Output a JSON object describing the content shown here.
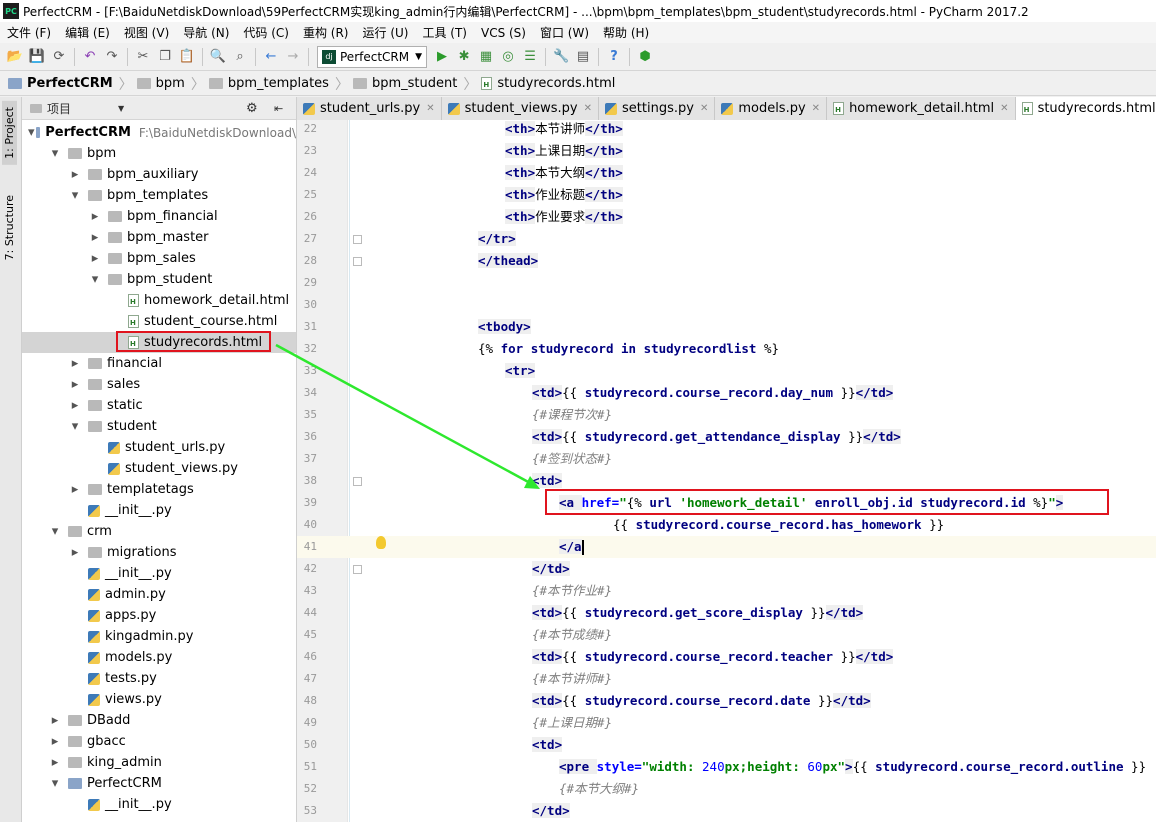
{
  "window": {
    "title": "PerfectCRM - [F:\\BaiduNetdiskDownload\\59PerfectCRM实现king_admin行内编辑\\PerfectCRM] - ...\\bpm\\bpm_templates\\bpm_student\\studyrecords.html - PyCharm 2017.2",
    "logo": "PC"
  },
  "menu": [
    "文件 (F)",
    "编辑 (E)",
    "视图 (V)",
    "导航 (N)",
    "代码 (C)",
    "重构 (R)",
    "运行 (U)",
    "工具 (T)",
    "VCS (S)",
    "窗口 (W)",
    "帮助 (H)"
  ],
  "toolbar": {
    "run_config": "PerfectCRM",
    "run_config_icon": "dj"
  },
  "breadcrumb": [
    "PerfectCRM",
    "bpm",
    "bpm_templates",
    "bpm_student",
    "studyrecords.html"
  ],
  "side_tabs": {
    "project": "1: Project",
    "structure": "7: Structure"
  },
  "project_panel": {
    "header": "项目",
    "root_path": "F:\\BaiduNetdiskDownload\\",
    "tree": [
      {
        "label": "PerfectCRM",
        "depth": 0,
        "kind": "folder",
        "open": true,
        "bold": true
      },
      {
        "label": "bpm",
        "depth": 1,
        "kind": "folder",
        "open": true
      },
      {
        "label": "bpm_auxiliary",
        "depth": 2,
        "kind": "folder",
        "open": false
      },
      {
        "label": "bpm_templates",
        "depth": 2,
        "kind": "folder",
        "open": true
      },
      {
        "label": "bpm_financial",
        "depth": 3,
        "kind": "folder",
        "open": false
      },
      {
        "label": "bpm_master",
        "depth": 3,
        "kind": "folder",
        "open": false
      },
      {
        "label": "bpm_sales",
        "depth": 3,
        "kind": "folder",
        "open": false
      },
      {
        "label": "bpm_student",
        "depth": 3,
        "kind": "folder",
        "open": true
      },
      {
        "label": "homework_detail.html",
        "depth": 4,
        "kind": "html"
      },
      {
        "label": "student_course.html",
        "depth": 4,
        "kind": "html"
      },
      {
        "label": "studyrecords.html",
        "depth": 4,
        "kind": "html",
        "selected": true
      },
      {
        "label": "financial",
        "depth": 2,
        "kind": "folder",
        "open": false
      },
      {
        "label": "sales",
        "depth": 2,
        "kind": "folder",
        "open": false
      },
      {
        "label": "static",
        "depth": 2,
        "kind": "folder",
        "open": false
      },
      {
        "label": "student",
        "depth": 2,
        "kind": "folder",
        "open": true
      },
      {
        "label": "student_urls.py",
        "depth": 3,
        "kind": "py"
      },
      {
        "label": "student_views.py",
        "depth": 3,
        "kind": "py"
      },
      {
        "label": "templatetags",
        "depth": 2,
        "kind": "folder",
        "open": false
      },
      {
        "label": "__init__.py",
        "depth": 2,
        "kind": "py"
      },
      {
        "label": "crm",
        "depth": 1,
        "kind": "folder",
        "open": true
      },
      {
        "label": "migrations",
        "depth": 2,
        "kind": "folder",
        "open": false
      },
      {
        "label": "__init__.py",
        "depth": 2,
        "kind": "py"
      },
      {
        "label": "admin.py",
        "depth": 2,
        "kind": "py"
      },
      {
        "label": "apps.py",
        "depth": 2,
        "kind": "py"
      },
      {
        "label": "kingadmin.py",
        "depth": 2,
        "kind": "py"
      },
      {
        "label": "models.py",
        "depth": 2,
        "kind": "py"
      },
      {
        "label": "tests.py",
        "depth": 2,
        "kind": "py"
      },
      {
        "label": "views.py",
        "depth": 2,
        "kind": "py"
      },
      {
        "label": "DBadd",
        "depth": 1,
        "kind": "folder",
        "open": false
      },
      {
        "label": "gbacc",
        "depth": 1,
        "kind": "folder",
        "open": false
      },
      {
        "label": "king_admin",
        "depth": 1,
        "kind": "folder",
        "open": false
      },
      {
        "label": "PerfectCRM",
        "depth": 1,
        "kind": "folder",
        "open": true
      },
      {
        "label": "__init__.py",
        "depth": 2,
        "kind": "py"
      }
    ]
  },
  "editor_tabs": [
    {
      "label": "student_urls.py",
      "kind": "py"
    },
    {
      "label": "student_views.py",
      "kind": "py"
    },
    {
      "label": "settings.py",
      "kind": "py"
    },
    {
      "label": "models.py",
      "kind": "py"
    },
    {
      "label": "homework_detail.html",
      "kind": "html"
    },
    {
      "label": "studyrecords.html",
      "kind": "html",
      "active": true
    }
  ],
  "code_lines": [
    {
      "n": 22,
      "i": 4,
      "segs": [
        [
          "<",
          "tg"
        ],
        [
          "th",
          "tg"
        ],
        [
          ">",
          "tg"
        ],
        [
          "本节讲师",
          ""
        ],
        [
          "</",
          "tg"
        ],
        [
          "th",
          "tg"
        ],
        [
          ">",
          "tg"
        ]
      ]
    },
    {
      "n": 23,
      "i": 4,
      "segs": [
        [
          "<th>",
          "tg"
        ],
        [
          "上课日期",
          ""
        ],
        [
          "</th>",
          "tg"
        ]
      ]
    },
    {
      "n": 24,
      "i": 4,
      "segs": [
        [
          "<th>",
          "tg"
        ],
        [
          "本节大纲",
          ""
        ],
        [
          "</th>",
          "tg"
        ]
      ]
    },
    {
      "n": 25,
      "i": 4,
      "segs": [
        [
          "<th>",
          "tg"
        ],
        [
          "作业标题",
          ""
        ],
        [
          "</th>",
          "tg"
        ]
      ]
    },
    {
      "n": 26,
      "i": 4,
      "segs": [
        [
          "<th>",
          "tg"
        ],
        [
          "作业要求",
          ""
        ],
        [
          "</th>",
          "tg"
        ]
      ]
    },
    {
      "n": 27,
      "i": 3,
      "segs": [
        [
          "</tr>",
          "tg"
        ]
      ]
    },
    {
      "n": 28,
      "i": 3,
      "segs": [
        [
          "</thead>",
          "tg"
        ]
      ]
    },
    {
      "n": 29,
      "i": 0,
      "segs": []
    },
    {
      "n": 30,
      "i": 0,
      "segs": []
    },
    {
      "n": 31,
      "i": 3,
      "segs": [
        [
          "<tbody>",
          "tg"
        ]
      ]
    },
    {
      "n": 32,
      "i": 3,
      "segs": [
        [
          "{% ",
          ""
        ],
        [
          "for ",
          "kw"
        ],
        [
          "studyrecord ",
          "var"
        ],
        [
          "in ",
          "kw"
        ],
        [
          "studyrecordlist",
          "var"
        ],
        [
          " %}",
          ""
        ]
      ]
    },
    {
      "n": 33,
      "i": 4,
      "segs": [
        [
          "<tr>",
          "tg"
        ]
      ]
    },
    {
      "n": 34,
      "i": 5,
      "segs": [
        [
          "<td>",
          "tg"
        ],
        [
          "{{ ",
          ""
        ],
        [
          "studyrecord.course_record.day_num",
          "var"
        ],
        [
          " }}",
          ""
        ],
        [
          "</td>",
          "tg"
        ]
      ]
    },
    {
      "n": 35,
      "i": 5,
      "segs": [
        [
          "{#课程节次#}",
          "cmt"
        ]
      ]
    },
    {
      "n": 36,
      "i": 5,
      "segs": [
        [
          "<td>",
          "tg"
        ],
        [
          "{{ ",
          ""
        ],
        [
          "studyrecord.get_attendance_display",
          "var"
        ],
        [
          " }}",
          ""
        ],
        [
          "</td>",
          "tg"
        ]
      ]
    },
    {
      "n": 37,
      "i": 5,
      "segs": [
        [
          "{#签到状态#}",
          "cmt"
        ]
      ]
    },
    {
      "n": 38,
      "i": 5,
      "segs": [
        [
          "<td>",
          "tg"
        ]
      ]
    },
    {
      "n": 39,
      "i": 6,
      "segs": [
        [
          "<a ",
          "tg"
        ],
        [
          "href=",
          "at"
        ],
        [
          "\"",
          "sv"
        ],
        [
          "{% ",
          ""
        ],
        [
          "url ",
          "kw"
        ],
        [
          "'homework_detail' ",
          "sv"
        ],
        [
          "enroll_obj.id studyrecord.id",
          "var"
        ],
        [
          " %}",
          ""
        ],
        [
          "\"",
          "sv"
        ],
        [
          ">",
          "tg"
        ]
      ]
    },
    {
      "n": 40,
      "i": 8,
      "segs": [
        [
          "{{ ",
          ""
        ],
        [
          "studyrecord.course_record.has_homework",
          "var"
        ],
        [
          " }}",
          ""
        ]
      ]
    },
    {
      "n": 41,
      "i": 6,
      "segs": [
        [
          "</a",
          "tg"
        ],
        [
          "CARET",
          ""
        ]
      ],
      "current": true
    },
    {
      "n": 42,
      "i": 5,
      "segs": [
        [
          "</td>",
          "tg"
        ]
      ]
    },
    {
      "n": 43,
      "i": 5,
      "segs": [
        [
          "{#本节作业#}",
          "cmt"
        ]
      ]
    },
    {
      "n": 44,
      "i": 5,
      "segs": [
        [
          "<td>",
          "tg"
        ],
        [
          "{{ ",
          ""
        ],
        [
          "studyrecord.get_score_display",
          "var"
        ],
        [
          " }}",
          ""
        ],
        [
          "</td>",
          "tg"
        ]
      ]
    },
    {
      "n": 45,
      "i": 5,
      "segs": [
        [
          "{#本节成绩#}",
          "cmt"
        ]
      ]
    },
    {
      "n": 46,
      "i": 5,
      "segs": [
        [
          "<td>",
          "tg"
        ],
        [
          "{{ ",
          ""
        ],
        [
          "studyrecord.course_record.teacher",
          "var"
        ],
        [
          " }}",
          ""
        ],
        [
          "</td>",
          "tg"
        ]
      ]
    },
    {
      "n": 47,
      "i": 5,
      "segs": [
        [
          "{#本节讲师#}",
          "cmt"
        ]
      ]
    },
    {
      "n": 48,
      "i": 5,
      "segs": [
        [
          "<td>",
          "tg"
        ],
        [
          "{{ ",
          ""
        ],
        [
          "studyrecord.course_record.date",
          "var"
        ],
        [
          " }}",
          ""
        ],
        [
          "</td>",
          "tg"
        ]
      ]
    },
    {
      "n": 49,
      "i": 5,
      "segs": [
        [
          "{#上课日期#}",
          "cmt"
        ]
      ]
    },
    {
      "n": 50,
      "i": 5,
      "segs": [
        [
          "<td>",
          "tg"
        ]
      ]
    },
    {
      "n": 51,
      "i": 6,
      "segs": [
        [
          "<pre ",
          "tg"
        ],
        [
          "style=",
          "at"
        ],
        [
          "\"",
          "sv"
        ],
        [
          "width: ",
          "sv"
        ],
        [
          "240",
          "num"
        ],
        [
          "px",
          "sv"
        ],
        [
          ";height: ",
          "sv"
        ],
        [
          "60",
          "num"
        ],
        [
          "px",
          "sv"
        ],
        [
          "\"",
          "sv"
        ],
        [
          ">",
          "tg"
        ],
        [
          "{{ ",
          ""
        ],
        [
          "studyrecord.course_record.outline",
          "var"
        ],
        [
          " }}",
          ""
        ]
      ]
    },
    {
      "n": 52,
      "i": 6,
      "segs": [
        [
          "{#本节大纲#}",
          "cmt"
        ]
      ]
    },
    {
      "n": 53,
      "i": 5,
      "segs": [
        [
          "</td>",
          "tg"
        ]
      ]
    }
  ],
  "colors": {
    "highlight_box": "#e0141e",
    "arrow": "#2ee82e",
    "current_line": "#fcfaed"
  }
}
